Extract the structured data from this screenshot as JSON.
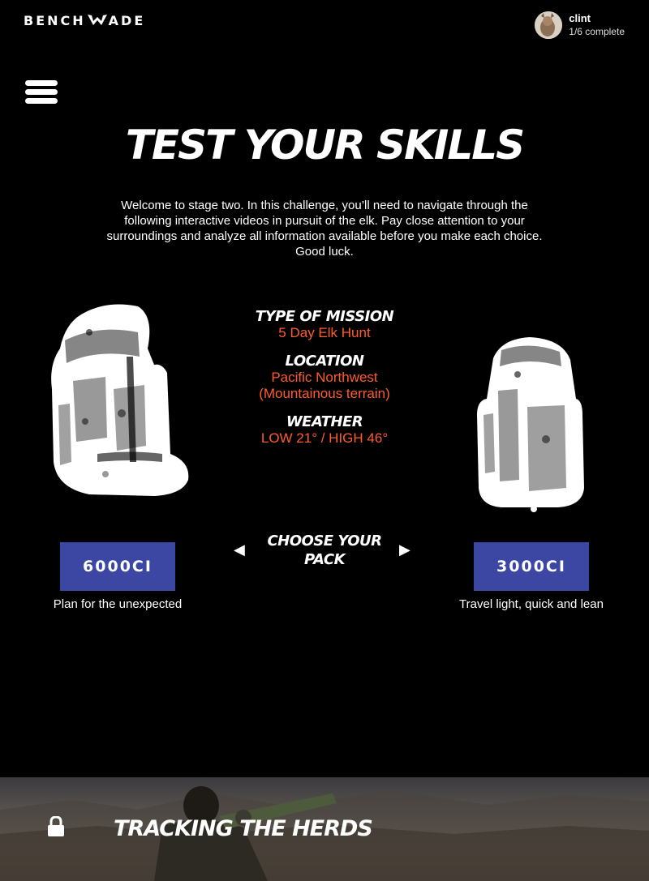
{
  "brand": {
    "logo_left": "BENCH",
    "logo_right": "ADE"
  },
  "user": {
    "name": "clint",
    "progress": "1/6 complete"
  },
  "page": {
    "title": "TEST YOUR SKILLS",
    "intro": "Welcome to stage two. In this challenge, you’ll need to navigate through the following interactive videos in pursuit of the elk. Pay close attention to your surroundings and analyze all information available before you make each choice. Good luck."
  },
  "mission": {
    "type_label": "TYPE OF MISSION",
    "type_value": "5 Day Elk Hunt",
    "location_label": "LOCATION",
    "location_value_1": "Pacific Northwest",
    "location_value_2": "(Mountainous terrain)",
    "weather_label": "WEATHER",
    "weather_value": "LOW 21° / HIGH 46°"
  },
  "choose": {
    "label": "CHOOSE YOUR PACK",
    "arrow_left": "◀",
    "arrow_right": "▶"
  },
  "packs": [
    {
      "label": "6000CI",
      "caption": "Plan for the unexpected"
    },
    {
      "label": "3000CI",
      "caption": "Travel light, quick and lean"
    }
  ],
  "next_stage": {
    "title": "TRACKING THE HERDS",
    "locked": true,
    "icon": "lock-icon"
  },
  "colors": {
    "accent": "#ff5c2e",
    "button": "#3c47a3",
    "background": "#000000"
  }
}
